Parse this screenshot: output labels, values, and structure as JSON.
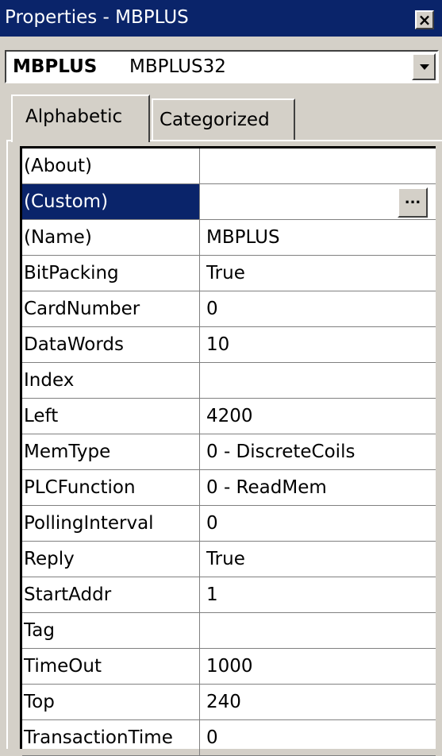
{
  "window": {
    "title": "Properties - MBPLUS",
    "close_symbol": "×"
  },
  "object_selector": {
    "name": "MBPLUS",
    "type": "MBPLUS32"
  },
  "tabs": [
    {
      "label": "Alphabetic",
      "active": true
    },
    {
      "label": "Categorized",
      "active": false
    }
  ],
  "properties": [
    {
      "name": "(About)",
      "value": ""
    },
    {
      "name": "(Custom)",
      "value": "",
      "selected": true,
      "button": "..."
    },
    {
      "name": "(Name)",
      "value": "MBPLUS"
    },
    {
      "name": "BitPacking",
      "value": "True"
    },
    {
      "name": "CardNumber",
      "value": "0"
    },
    {
      "name": "DataWords",
      "value": "10"
    },
    {
      "name": "Index",
      "value": ""
    },
    {
      "name": "Left",
      "value": "4200"
    },
    {
      "name": "MemType",
      "value": "0 - DiscreteCoils"
    },
    {
      "name": "PLCFunction",
      "value": "0 - ReadMem"
    },
    {
      "name": "PollingInterval",
      "value": "0"
    },
    {
      "name": "Reply",
      "value": "True"
    },
    {
      "name": "StartAddr",
      "value": "1"
    },
    {
      "name": "Tag",
      "value": ""
    },
    {
      "name": "TimeOut",
      "value": "1000"
    },
    {
      "name": "Top",
      "value": "240"
    },
    {
      "name": "TransactionTime",
      "value": "0"
    }
  ],
  "colors": {
    "title_bar": "#0a246a",
    "face": "#d4d0c8",
    "selection": "#0a246a"
  }
}
